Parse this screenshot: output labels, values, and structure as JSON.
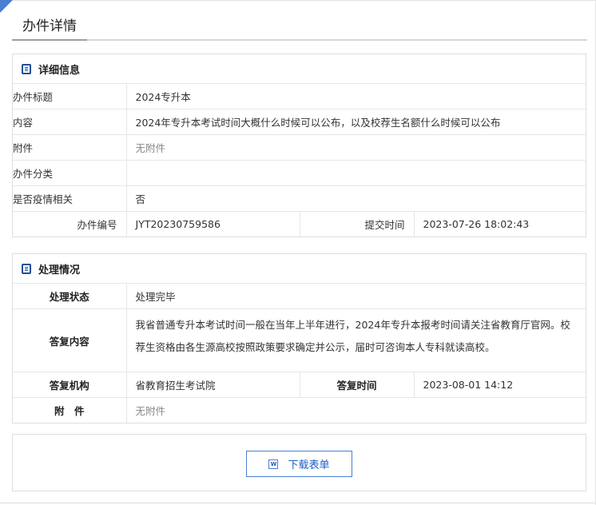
{
  "page": {
    "title": "办件详情"
  },
  "detail": {
    "heading": "详细信息",
    "rows": [
      {
        "label": "办件标题",
        "value": "2024专升本"
      },
      {
        "label": "内容",
        "value": "2024年专升本考试时间大概什么时候可以公布，以及校荐生名额什么时候可以公布"
      },
      {
        "label": "附件",
        "value": "无附件"
      },
      {
        "label": "办件分类",
        "value": ""
      },
      {
        "label": "是否疫情相关",
        "value": "否"
      }
    ],
    "number_label": "办件编号",
    "number_value": "JYT20230759586",
    "submit_label": "提交时间",
    "submit_value": "2023-07-26 18:02:43"
  },
  "process": {
    "heading": "处理情况",
    "status_label": "处理状态",
    "status_value": "处理完毕",
    "reply_label": "答复内容",
    "reply_value": "我省普通专升本考试时间一般在当年上半年进行，2024年专升本报考时间请关注省教育厅官网。校荐生资格由各生源高校按照政策要求确定并公示，届时可咨询本人专科就读高校。",
    "org_label": "答复机构",
    "org_value": "省教育招生考试院",
    "time_label": "答复时间",
    "time_value": "2023-08-01 14:12",
    "attach_label": "附　件",
    "attach_value": "无附件"
  },
  "download": {
    "label": "下载表单",
    "icon": "word-icon",
    "icon_text": "W"
  },
  "colors": {
    "accent": "#4a7fd1",
    "icon": "#1f4e9a",
    "border": "#dedede"
  }
}
